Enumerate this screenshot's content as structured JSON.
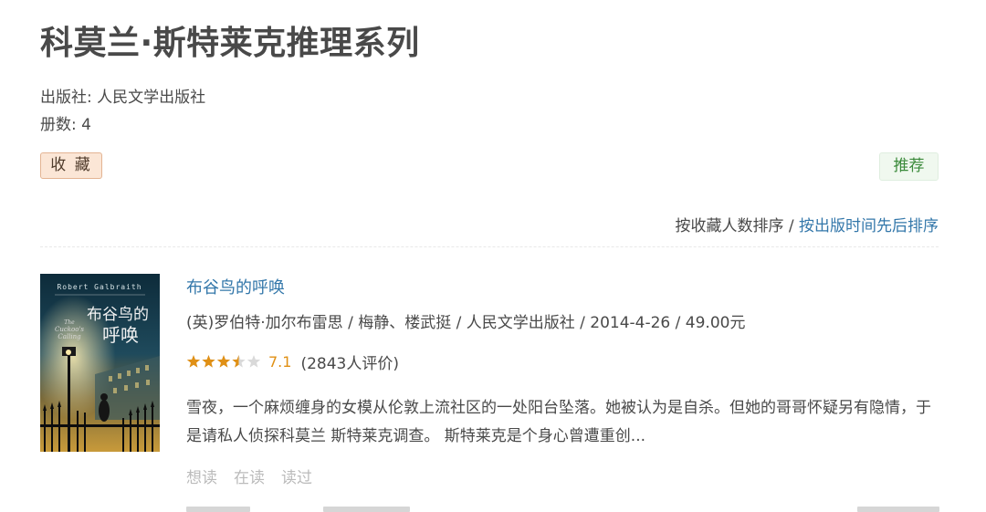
{
  "series": {
    "title": "科莫兰·斯特莱克推理系列",
    "publisher_line": "出版社: 人民文学出版社",
    "count_line": "册数: 4",
    "collect_label": "收 藏",
    "recommend_label": "推荐"
  },
  "sort": {
    "by_collect": "按收藏人数排序",
    "separator": " / ",
    "by_date": "按出版时间先后排序"
  },
  "book": {
    "title": "布谷鸟的呼唤",
    "pub_info": "(英)罗伯特·加尔布雷思 / 梅静、楼武挺 / 人民文学出版社 / 2014-4-26 / 49.00元",
    "stars_value": 3.5,
    "stars_max": 5,
    "rating": "7.1",
    "rating_count": "(2843人评价)",
    "description": "雪夜，一个麻烦缠身的女模从伦敦上流社区的一处阳台坠落。她被认为是自杀。但她的哥哥怀疑另有隐情，于是请私人侦探科莫兰 斯特莱克调查。 斯特莱克是个身心曾遭重创...",
    "actions": [
      "想读",
      "在读",
      "读过"
    ],
    "cover": {
      "author": "Robert Galbraith",
      "title_cn_1": "布谷鸟的",
      "title_cn_2": "呼唤",
      "title_en_1": "The",
      "title_en_2": "Cuckoo's",
      "title_en_3": "Calling"
    }
  },
  "colors": {
    "link": "#3377aa",
    "star": "#e09015",
    "collect_bg": "#fbe6d6",
    "recommend_text": "#3b8a3b"
  }
}
